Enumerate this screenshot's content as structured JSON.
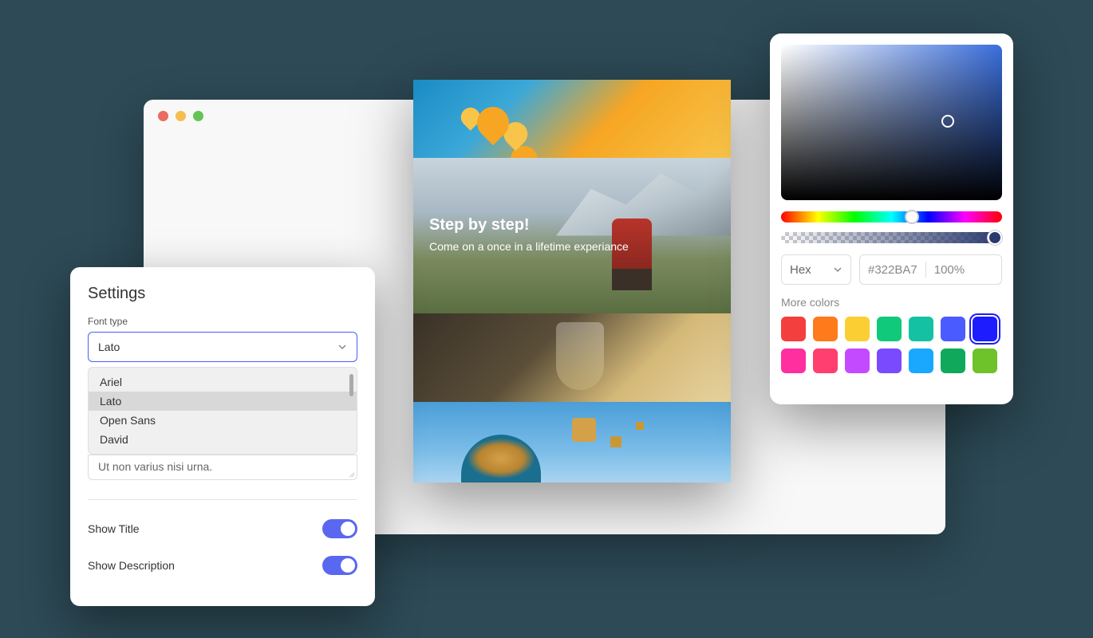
{
  "settings": {
    "title": "Settings",
    "font_label": "Font type",
    "font_selected": "Lato",
    "font_options": [
      "Ariel",
      "Lato",
      "Open Sans",
      "David"
    ],
    "textarea_value": "Ut non varius nisi urna.",
    "show_title_label": "Show Title",
    "show_description_label": "Show Description"
  },
  "preview": {
    "overlay_title": "Step by step!",
    "overlay_subtitle": "Come on a once in a lifetime experiance"
  },
  "color_picker": {
    "format": "Hex",
    "hex_value": "#322BA7",
    "opacity": "100%",
    "more_label": "More colors",
    "swatches_row1": [
      "#f43f3f",
      "#ff7a1a",
      "#fbcf33",
      "#10c97b",
      "#14c2a3",
      "#4a5cff",
      "#1c1cff"
    ],
    "swatches_row2": [
      "#ff2fa0",
      "#ff3f6f",
      "#c44aff",
      "#7a4aff",
      "#1aa8ff",
      "#10a95b",
      "#6ec22a"
    ],
    "selected_swatch": "#1c1cff"
  }
}
